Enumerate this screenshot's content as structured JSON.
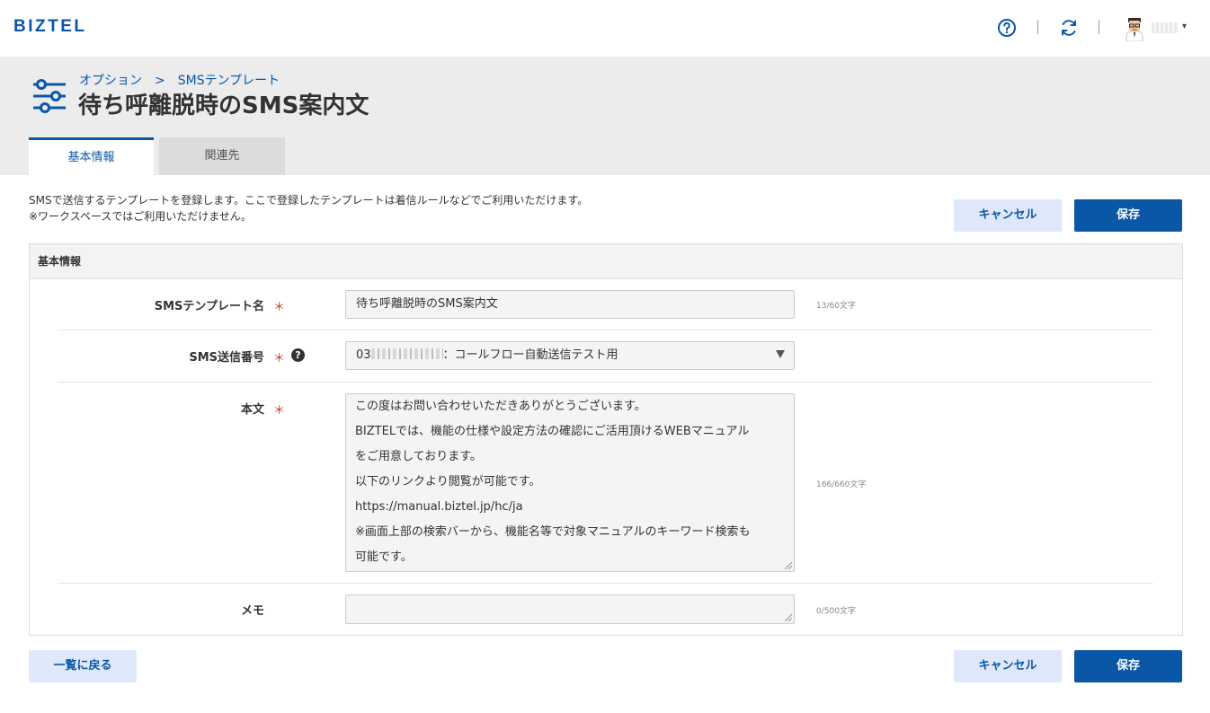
{
  "app": {
    "logo": "BIZTEL"
  },
  "topbar": {
    "help_icon": "question-circle-icon",
    "sync_icon": "refresh-icon",
    "user_caret": "▾"
  },
  "breadcrumb": {
    "parent": "オプション",
    "separator": ">",
    "current": "SMSテンプレート"
  },
  "page": {
    "title": "待ち呼離脱時のSMS案内文"
  },
  "tabs": [
    {
      "label": "基本情報",
      "active": true
    },
    {
      "label": "関連先",
      "active": false
    }
  ],
  "description": {
    "line1": "SMSで送信するテンプレートを登録します。ここで登録したテンプレートは着信ルールなどでご利用いただけます。",
    "line2": "※ワークスペースではご利用いただけません。"
  },
  "buttons": {
    "cancel": "キャンセル",
    "save": "保存",
    "back": "一覧に戻る"
  },
  "panel": {
    "title": "基本情報"
  },
  "form": {
    "required_mark": "＊",
    "name": {
      "label": "SMSテンプレート名",
      "value": "待ち呼離脱時のSMS案内文",
      "counter": "13/60文字"
    },
    "number": {
      "label": "SMS送信番号",
      "prefix": "03",
      "suffix": "：コールフロー自動送信テスト用"
    },
    "body": {
      "label": "本文",
      "lines": [
        "この度はお問い合わせいただきありがとうございます。",
        "BIZTELでは、機能の仕様や設定方法の確認にご活用頂けるWEBマニュアル",
        "をご用意しております。",
        "以下のリンクより閲覧が可能です。",
        "https://manual.biztel.jp/hc/ja",
        "※画面上部の検索バーから、機能名等で対象マニュアルのキーワード検索も",
        "可能です。"
      ],
      "counter": "166/660文字"
    },
    "memo": {
      "label": "メモ",
      "value": "",
      "counter": "0/500文字"
    }
  },
  "colors": {
    "brand": "#0a57a8",
    "required": "#c0392b",
    "header_bg": "#ececec"
  }
}
